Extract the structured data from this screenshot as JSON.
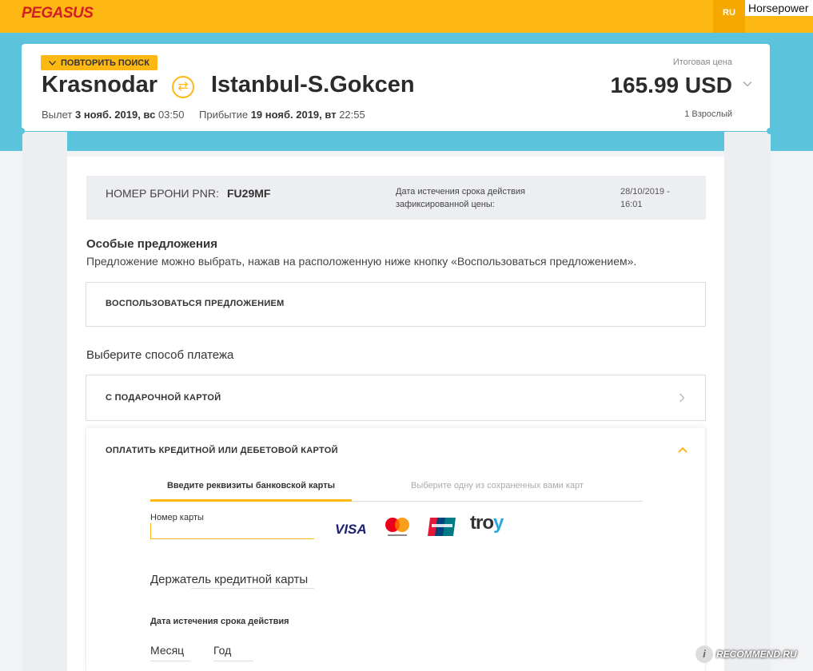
{
  "header": {
    "logo": "PEGASUS",
    "lang": "RU",
    "watermark": "Horsepower"
  },
  "summary": {
    "repeat_search": "ПОВТОРИТЬ ПОИСК",
    "from": "Krasnodar",
    "to": "Istanbul-S.Gokcen",
    "departure_label": "Вылет",
    "departure_date": "3 нояб. 2019, вс",
    "departure_time": "03:50",
    "arrival_label": "Прибытие",
    "arrival_date": "19 нояб. 2019, вт",
    "arrival_time": "22:55",
    "total_label": "Итоговая цена",
    "price": "165.99 USD",
    "passengers": "1 Взрослый"
  },
  "pnr": {
    "label": "НОМЕР БРОНИ PNR:",
    "value": "FU29MF",
    "expiry_label": "Дата истечения срока действия зафиксированной цены:",
    "expiry_value": "28/10/2019 - 16:01"
  },
  "offers": {
    "title": "Особые предложения",
    "description": "Предложение можно выбрать, нажав на расположенную ниже кнопку «Воспользоваться предложением».",
    "button": "ВОСПОЛЬЗОВАТЬСЯ ПРЕДЛОЖЕНИЕМ"
  },
  "payment": {
    "title": "Выберите способ платежа",
    "gift_card": "С ПОДАРОЧНОЙ КАРТОЙ",
    "card_option": "ОПЛАТИТЬ КРЕДИТНОЙ ИЛИ ДЕБЕТОВОЙ КАРТОЙ",
    "tabs": [
      "Введите реквизиты банковской карты",
      "Выберите одну из сохраненных вами карт"
    ],
    "card_number_label": "Номер карты",
    "card_number_value": "",
    "brands": [
      "VISA",
      "mastercard",
      "UnionPay",
      "troy"
    ],
    "holder_label": "Держатель кредитной карты",
    "expiry_label": "Дата истечения срока действия",
    "month_placeholder": "Месяц",
    "year_placeholder": "Год"
  },
  "footer": {
    "watermark": "RECOMMEND.RU"
  },
  "colors": {
    "brand_yellow": "#fdb813",
    "brand_red": "#d31e24",
    "teal": "#5cc3dc"
  }
}
